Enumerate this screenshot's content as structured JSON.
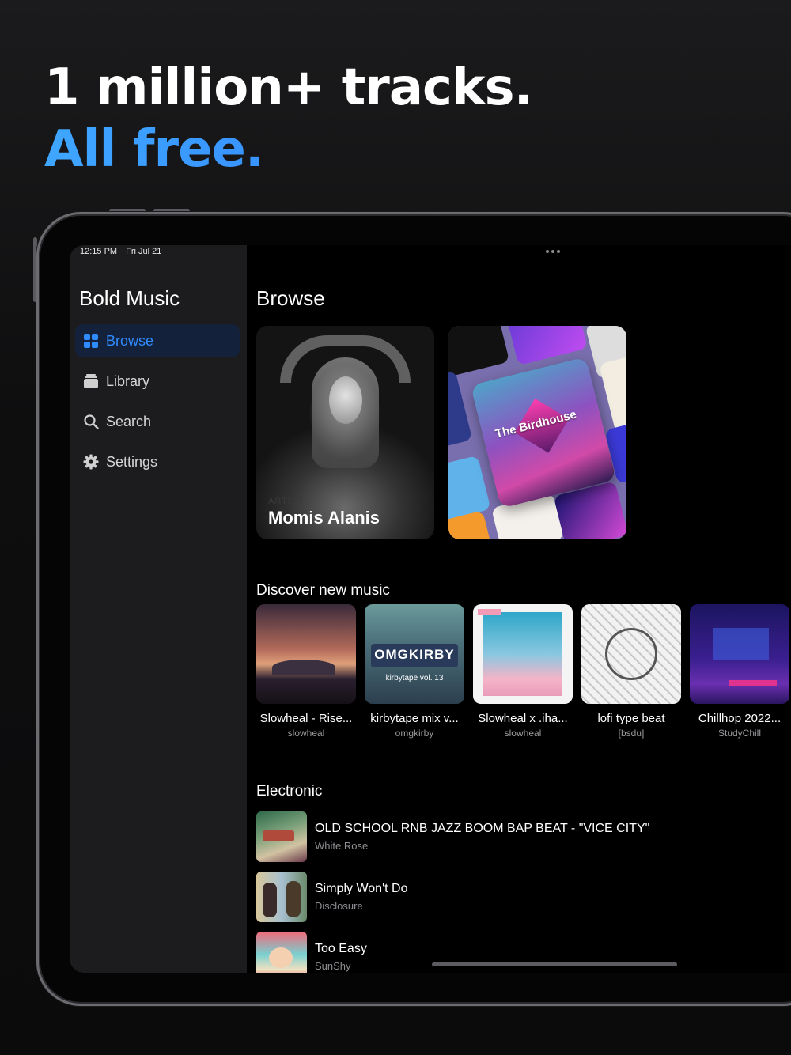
{
  "headline": {
    "line1": "1 million+ tracks.",
    "line2": "All free."
  },
  "status_bar": {
    "time": "12:15 PM",
    "date": "Fri Jul 21"
  },
  "sidebar": {
    "app_title": "Bold Music",
    "items": [
      {
        "label": "Browse",
        "icon": "grid-icon",
        "active": true
      },
      {
        "label": "Library",
        "icon": "library-stack-icon",
        "active": false
      },
      {
        "label": "Search",
        "icon": "search-icon",
        "active": false
      },
      {
        "label": "Settings",
        "icon": "gear-icon",
        "active": false
      }
    ]
  },
  "main": {
    "title": "Browse",
    "featured": {
      "artist": {
        "kicker": "ARTIST",
        "name": "Momis Alanis"
      },
      "collage": {
        "label": "The Birdhouse"
      }
    },
    "discover": {
      "title": "Discover new music",
      "albums": [
        {
          "title": "Slowheal - Rise...",
          "artist": "slowheal"
        },
        {
          "title": "kirbytape mix v...",
          "artist": "omgkirby"
        },
        {
          "title": "Slowheal x .iha...",
          "artist": "slowheal"
        },
        {
          "title": "lofi type beat",
          "artist": "[bsdu]"
        },
        {
          "title": "Chillhop  2022...",
          "artist": "StudyChill"
        }
      ]
    },
    "electronic": {
      "title": "Electronic",
      "tracks": [
        {
          "title": "OLD SCHOOL RNB JAZZ BOOM BAP BEAT - \"VICE CITY\"",
          "artist": "White Rose"
        },
        {
          "title": "Simply Won't Do",
          "artist": "Disclosure"
        },
        {
          "title": "Too Easy",
          "artist": "SunShy"
        }
      ]
    }
  },
  "colors": {
    "accent": "#2f8bff",
    "sidebar_bg": "#1c1c1e",
    "active_bg": "#14213a"
  }
}
